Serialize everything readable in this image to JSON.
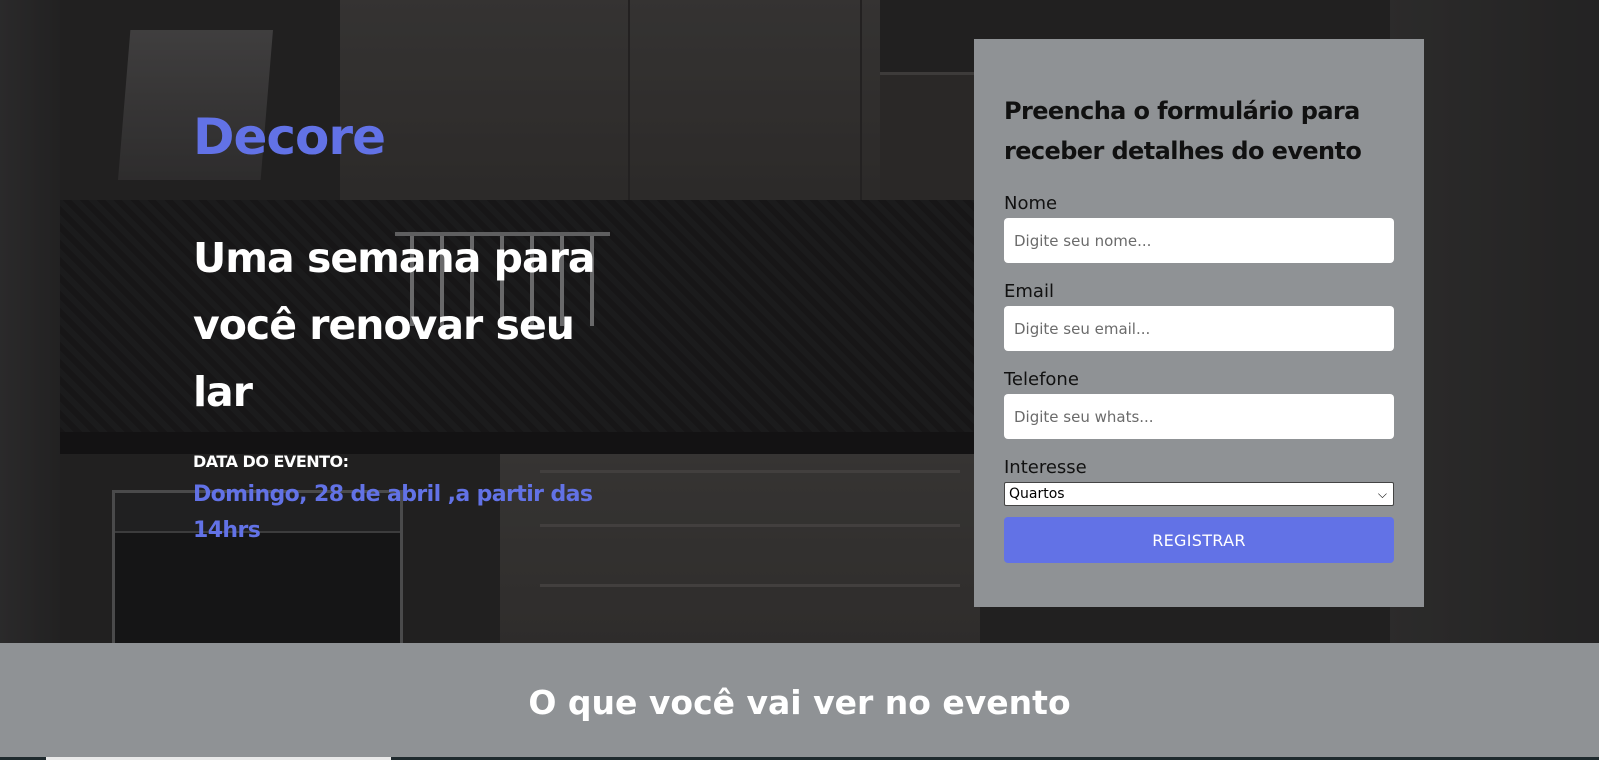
{
  "hero": {
    "brand": "Decore",
    "headline": "Uma semana para você renovar seu lar",
    "event_label": "DATA DO EVENTO:",
    "event_date": "Domingo, 28 de abril ,a partir das 14hrs"
  },
  "form": {
    "title": "Preencha o formulário para receber detalhes do evento",
    "fields": [
      {
        "label": "Nome",
        "placeholder": "Digite seu nome..."
      },
      {
        "label": "Email",
        "placeholder": "Digite seu email..."
      },
      {
        "label": "Telefone",
        "placeholder": "Digite seu whats..."
      }
    ],
    "interest": {
      "label": "Interesse",
      "selected": "Quartos"
    },
    "submit_label": "REGISTRAR"
  },
  "section": {
    "title": "O que você vai ver no evento"
  },
  "colors": {
    "accent": "#6272e6",
    "form_background": "#8f9295"
  }
}
